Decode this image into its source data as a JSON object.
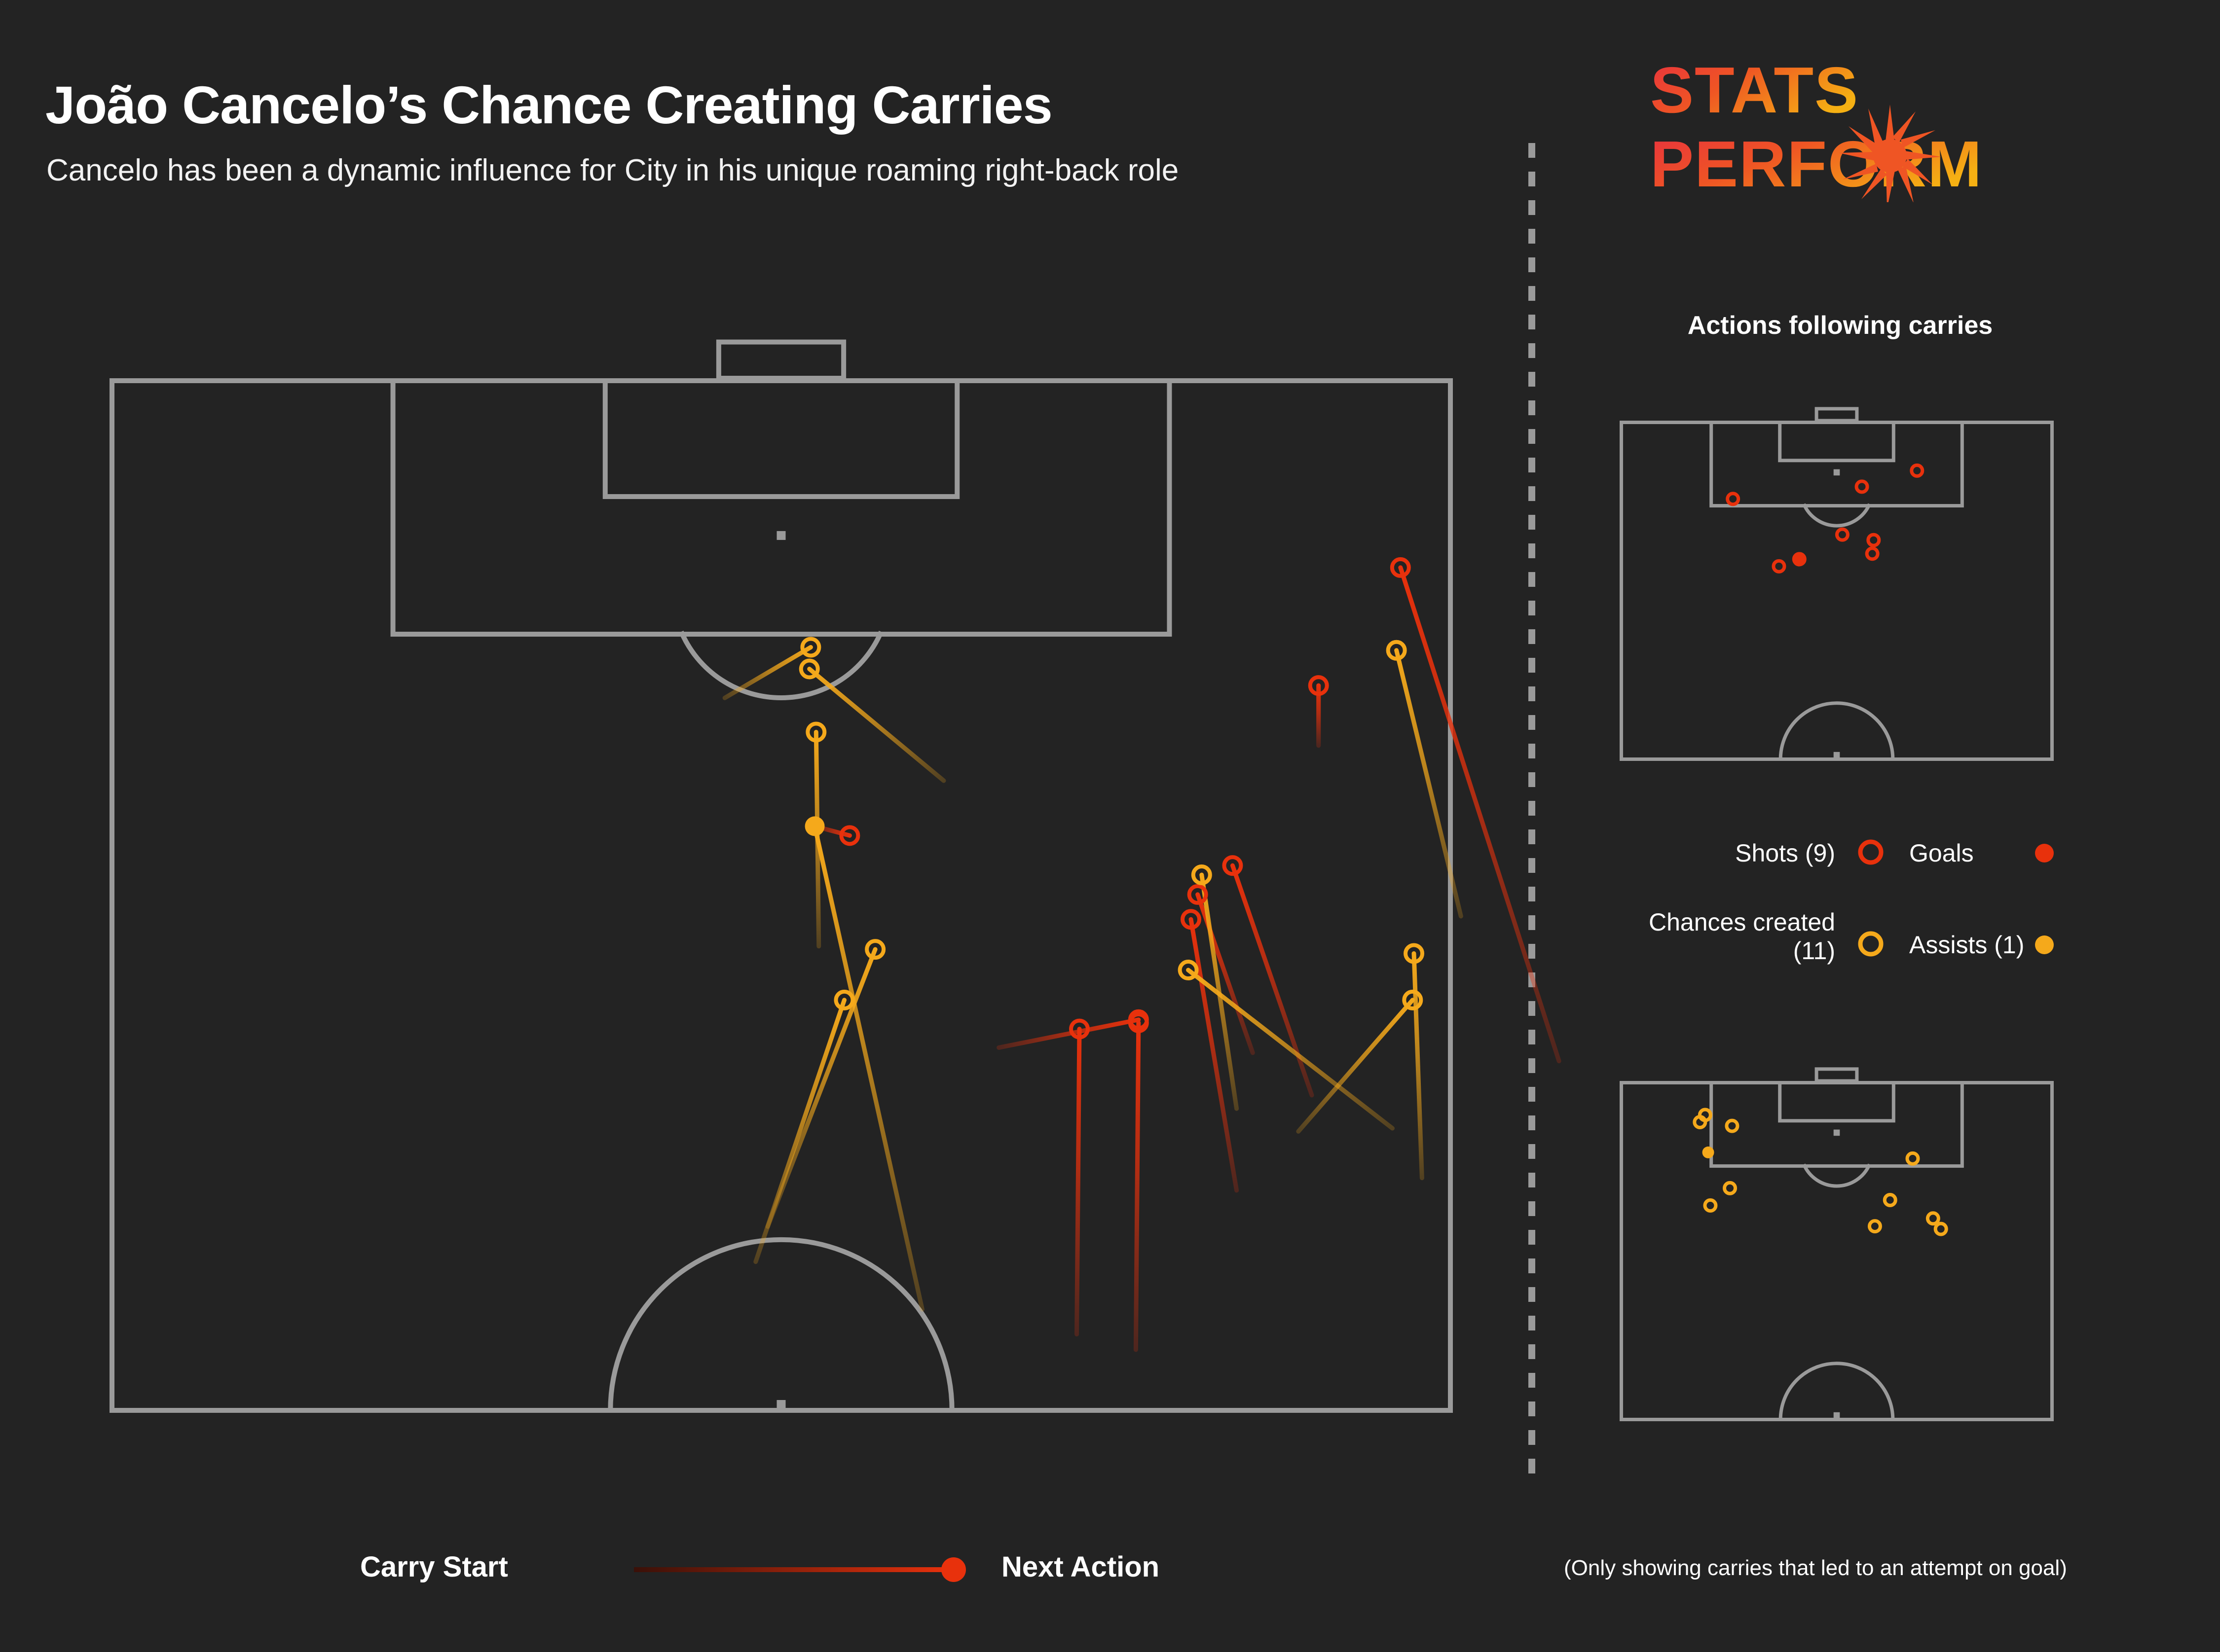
{
  "header": {
    "title": "João Cancelo’s Chance Creating Carries",
    "subtitle": "Cancelo has been a dynamic influence for City in his unique roaming right-back role"
  },
  "brand": {
    "line1": "STATS",
    "line2": "PERFORM",
    "icon": "starburst-icon",
    "gradient_start": "#e8313f",
    "gradient_end": "#f5a91b"
  },
  "right_panel": {
    "heading": "Actions following carries",
    "legend": [
      {
        "label": "Shots (9)",
        "marker": "ring",
        "color": "#e8310c"
      },
      {
        "label": "Goals",
        "marker": "dot",
        "color": "#e8310c"
      },
      {
        "label": "Chances created (11)",
        "marker": "ring",
        "color": "#f5a91b"
      },
      {
        "label": "Assists (1)",
        "marker": "dot",
        "color": "#f5a91b"
      }
    ]
  },
  "bottom_legend": {
    "start_label": "Carry Start",
    "end_label": "Next Action",
    "line_from_color": "#3a1008",
    "line_to_color": "#e8310c"
  },
  "footnote": "(Only showing carries that led to an attempt on goal)",
  "colors": {
    "background": "#232323",
    "pitch_lines": "#9a9a9a",
    "shot_red": "#e8310c",
    "chance_orange": "#f5a91b",
    "faded_start": "#3a2a12"
  },
  "chart_data": {
    "type": "scatter",
    "title": "João Cancelo’s Chance Creating Carries",
    "subtitle": "Cancelo has been a dynamic influence for City in his unique roaming right-back role",
    "description": "Football pitch map. Each carry is drawn as a line fading from dark (carry start) to bright (next action) with a marker at the end point. Red = shot, orange = chance created. Filled markers = goal / assist.",
    "legend_position": "right",
    "pitch_main": {
      "orientation": "attacking-up",
      "x_range": [
        0,
        100
      ],
      "y_range": [
        0,
        100
      ],
      "note": "x is left-to-right across pitch width, y is 0 at the attacking goal line (top) to 100 at bottom of shown half"
    },
    "carries": [
      {
        "id": 1,
        "type": "chance",
        "color": "#f5a91b",
        "start": [
          -4.2,
          30.9
        ],
        "end": [
          2.2,
          26.0
        ],
        "end_marker": "ring"
      },
      {
        "id": 2,
        "type": "chance",
        "color": "#f5a91b",
        "start": [
          12.1,
          38.9
        ],
        "end": [
          2.1,
          28.1
        ],
        "end_marker": "ring"
      },
      {
        "id": 3,
        "type": "chance",
        "color": "#f5a91b",
        "start": [
          2.8,
          54.9
        ],
        "end": [
          2.6,
          34.2
        ],
        "end_marker": "ring"
      },
      {
        "id": 4,
        "type": "chance",
        "color": "#f5a91b",
        "start": [
          10.5,
          90.0
        ],
        "end": [
          2.5,
          43.3
        ],
        "end_marker": "dot",
        "outcome": "assist"
      },
      {
        "id": 5,
        "type": "shot",
        "color": "#e8310c",
        "start": [
          2.5,
          43.3
        ],
        "end": [
          5.1,
          44.2
        ],
        "end_marker": "ring"
      },
      {
        "id": 6,
        "type": "chance",
        "color": "#f5a91b",
        "start": [
          -1.0,
          82.0
        ],
        "end": [
          7.0,
          55.2
        ],
        "end_marker": "ring"
      },
      {
        "id": 7,
        "type": "chance",
        "color": "#f5a91b",
        "start": [
          -1.9,
          85.4
        ],
        "end": [
          4.7,
          60.1
        ],
        "end_marker": "ring"
      },
      {
        "id": 8,
        "type": "shot",
        "color": "#e8310c",
        "start": [
          16.2,
          64.7
        ],
        "end": [
          26.6,
          62.0
        ],
        "end_marker": "ring"
      },
      {
        "id": 9,
        "type": "shot",
        "color": "#e8310c",
        "start": [
          26.4,
          93.9
        ],
        "end": [
          26.6,
          62.3
        ],
        "end_marker": "ring"
      },
      {
        "id": 10,
        "type": "shot",
        "color": "#e8310c",
        "start": [
          22.0,
          92.4
        ],
        "end": [
          22.2,
          62.9
        ],
        "end_marker": "ring"
      },
      {
        "id": 11,
        "type": "shot",
        "color": "#e8310c",
        "start": [
          40.0,
          35.5
        ],
        "end": [
          40.0,
          29.7
        ],
        "end_marker": "ring"
      },
      {
        "id": 12,
        "type": "shot",
        "color": "#e8310c",
        "start": [
          57.9,
          66.0
        ],
        "end": [
          46.1,
          18.3
        ],
        "end_marker": "ring"
      },
      {
        "id": 13,
        "type": "chance",
        "color": "#f5a91b",
        "start": [
          50.6,
          52.0
        ],
        "end": [
          45.8,
          26.3
        ],
        "end_marker": "ring"
      },
      {
        "id": 14,
        "type": "shot",
        "color": "#e8310c",
        "start": [
          39.5,
          69.3
        ],
        "end": [
          33.6,
          47.1
        ],
        "end_marker": "ring"
      },
      {
        "id": 15,
        "type": "shot",
        "color": "#e8310c",
        "start": [
          35.1,
          65.2
        ],
        "end": [
          31.0,
          49.9
        ],
        "end_marker": "ring"
      },
      {
        "id": 16,
        "type": "chance",
        "color": "#f5a91b",
        "start": [
          33.9,
          70.6
        ],
        "end": [
          31.3,
          48.0
        ],
        "end_marker": "ring"
      },
      {
        "id": 17,
        "type": "shot",
        "color": "#e8310c",
        "start": [
          33.9,
          78.5
        ],
        "end": [
          30.5,
          52.3
        ],
        "end_marker": "ring"
      },
      {
        "id": 18,
        "type": "chance",
        "color": "#f5a91b",
        "start": [
          45.5,
          72.5
        ],
        "end": [
          30.3,
          57.2
        ],
        "end_marker": "ring"
      },
      {
        "id": 19,
        "type": "chance",
        "color": "#f5a91b",
        "start": [
          38.5,
          72.8
        ],
        "end": [
          47.0,
          60.1
        ],
        "end_marker": "ring"
      },
      {
        "id": 20,
        "type": "chance",
        "color": "#f5a91b",
        "start": [
          47.7,
          77.3
        ],
        "end": [
          47.1,
          55.6
        ],
        "end_marker": "ring"
      }
    ],
    "mini_pitch_shots": {
      "title": "Shots",
      "marker_color": "#e8310c",
      "points": [
        {
          "x": 68.5,
          "y": 14.7,
          "filled": false
        },
        {
          "x": 55.8,
          "y": 19.4,
          "filled": false
        },
        {
          "x": 26.1,
          "y": 23.0,
          "filled": false
        },
        {
          "x": 51.3,
          "y": 33.5,
          "filled": false
        },
        {
          "x": 58.5,
          "y": 35.1,
          "filled": false
        },
        {
          "x": 58.2,
          "y": 39.1,
          "filled": false
        },
        {
          "x": 41.4,
          "y": 40.7,
          "filled": false
        },
        {
          "x": 41.3,
          "y": 41.1,
          "filled": true,
          "outcome": "goal"
        },
        {
          "x": 36.7,
          "y": 42.8,
          "filled": false
        }
      ]
    },
    "mini_pitch_chances": {
      "title": "Chances created",
      "marker_color": "#f5a91b",
      "points": [
        {
          "x": 19.7,
          "y": 10.0,
          "filled": false
        },
        {
          "x": 18.5,
          "y": 12.1,
          "filled": false
        },
        {
          "x": 25.9,
          "y": 13.2,
          "filled": false
        },
        {
          "x": 20.4,
          "y": 21.0,
          "filled": true,
          "outcome": "assist"
        },
        {
          "x": 67.5,
          "y": 22.8,
          "filled": false
        },
        {
          "x": 25.4,
          "y": 31.5,
          "filled": false
        },
        {
          "x": 20.9,
          "y": 36.6,
          "filled": false
        },
        {
          "x": 62.3,
          "y": 35.0,
          "filled": false
        },
        {
          "x": 58.8,
          "y": 42.7,
          "filled": false
        },
        {
          "x": 74.0,
          "y": 43.5,
          "filled": false
        },
        {
          "x": 72.2,
          "y": 40.4,
          "filled": false
        }
      ]
    }
  }
}
